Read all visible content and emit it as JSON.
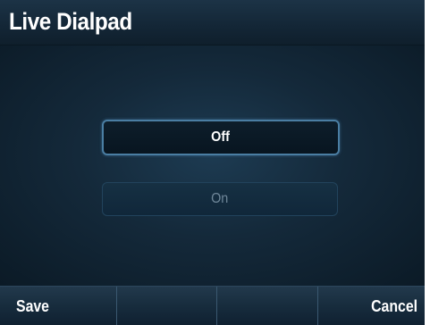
{
  "screen": {
    "title": "Live Dialpad"
  },
  "options": {
    "off_label": "Off",
    "on_label": "On",
    "selected": "Off"
  },
  "softkeys": {
    "key1": "Save",
    "key2": "",
    "key3": "",
    "key4": "Cancel"
  },
  "colors": {
    "background": "#0a1a26",
    "selected_border": "#4a7ea3",
    "text_active": "#ffffff",
    "text_inactive": "#6f8799"
  }
}
